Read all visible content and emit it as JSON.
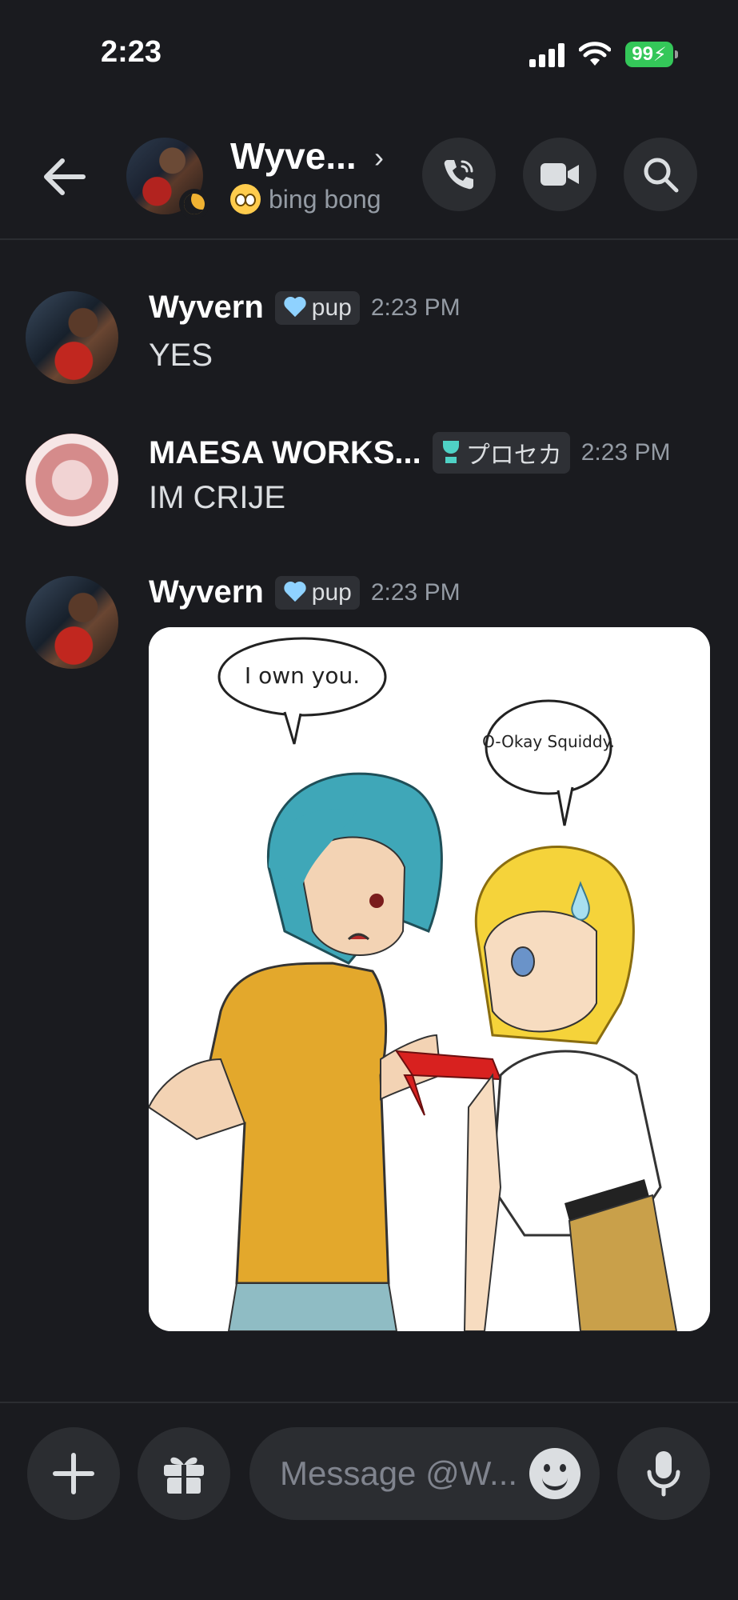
{
  "status_bar": {
    "time": "2:23",
    "battery": "99"
  },
  "header": {
    "name": "Wyve...",
    "status_text": "bing bong",
    "avatar": "user-avatar",
    "icons": [
      "back-arrow-icon",
      "phone-call-icon",
      "video-camera-icon",
      "search-icon"
    ]
  },
  "messages": [
    {
      "author": "Wyvern",
      "tag": "pup",
      "tag_icon": "heart-icon",
      "time": "2:23 PM",
      "text": "YES"
    },
    {
      "author": "MAESA WORKS...",
      "tag": "プロセカ",
      "tag_icon": "trophy-icon",
      "time": "2:23 PM",
      "text": "IM CRIJE"
    },
    {
      "author": "Wyvern",
      "tag": "pup",
      "tag_icon": "heart-icon",
      "time": "2:23 PM",
      "attachment": {
        "bubble_left": "I own you.",
        "bubble_right": "O-Okay Squiddy."
      }
    }
  ],
  "input": {
    "placeholder": "Message @W..."
  },
  "colors": {
    "background": "#1a1b1f",
    "surface": "#2b2d31",
    "muted": "#949ba4",
    "battery": "#34c759"
  }
}
